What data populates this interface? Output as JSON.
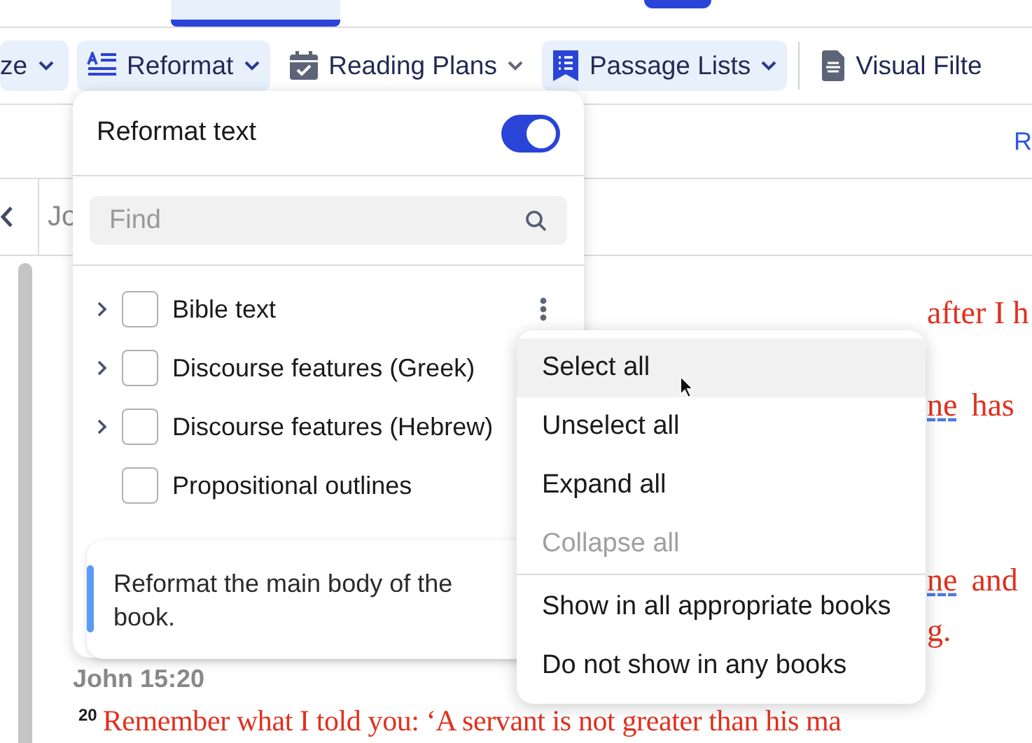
{
  "toolbar": {
    "items": [
      {
        "label": "ze",
        "kind": "none",
        "highlighted": true
      },
      {
        "label": "Reformat",
        "kind": "reformat",
        "highlighted": true
      },
      {
        "label": "Reading Plans",
        "kind": "calendar",
        "highlighted": false
      },
      {
        "label": "Passage Lists",
        "kind": "list",
        "highlighted": true
      },
      {
        "label": "Visual Filte",
        "kind": "document",
        "highlighted": false,
        "divider_before": true
      }
    ]
  },
  "subbar": {
    "link": "R"
  },
  "nav": {
    "title": "Jo"
  },
  "reformat_panel": {
    "toggle": {
      "label": "Reformat text",
      "on": true
    },
    "search": {
      "placeholder": "Find"
    },
    "items": [
      {
        "label": "Bible text",
        "expandable": true,
        "checked": false,
        "has_menu": true
      },
      {
        "label": "Discourse features (Greek)",
        "expandable": true,
        "checked": false,
        "has_menu": false
      },
      {
        "label": "Discourse features (Hebrew)",
        "expandable": true,
        "checked": false,
        "has_menu": false
      },
      {
        "label": "Propositional outlines",
        "expandable": false,
        "checked": false,
        "has_menu": false
      }
    ],
    "description": "Reformat the main body of the book."
  },
  "context_menu": {
    "groups": [
      [
        {
          "label": "Select all",
          "disabled": false,
          "selected": true
        },
        {
          "label": "Unselect all",
          "disabled": false,
          "selected": false
        },
        {
          "label": "Expand all",
          "disabled": false,
          "selected": false
        },
        {
          "label": "Collapse all",
          "disabled": true,
          "selected": false
        }
      ],
      [
        {
          "label": "Show in all appropriate books",
          "disabled": false,
          "selected": false
        },
        {
          "label": "Do not show in any books",
          "disabled": false,
          "selected": false
        }
      ]
    ]
  },
  "reader": {
    "fragments": [
      [
        {
          "text": "after I h",
          "linked": false
        }
      ],
      [
        {
          "text": "ne",
          "linked": true
        },
        {
          "text": "has",
          "linked": false
        }
      ],
      [
        {
          "text": "ne",
          "linked": true
        },
        {
          "text": "and",
          "linked": false
        }
      ],
      [
        {
          "text": "g.",
          "linked": false
        }
      ]
    ],
    "heading": "John 15:20",
    "verse": {
      "number": "20",
      "text": "Remember what I told you: ‘A servant is not greater than his ma"
    }
  }
}
